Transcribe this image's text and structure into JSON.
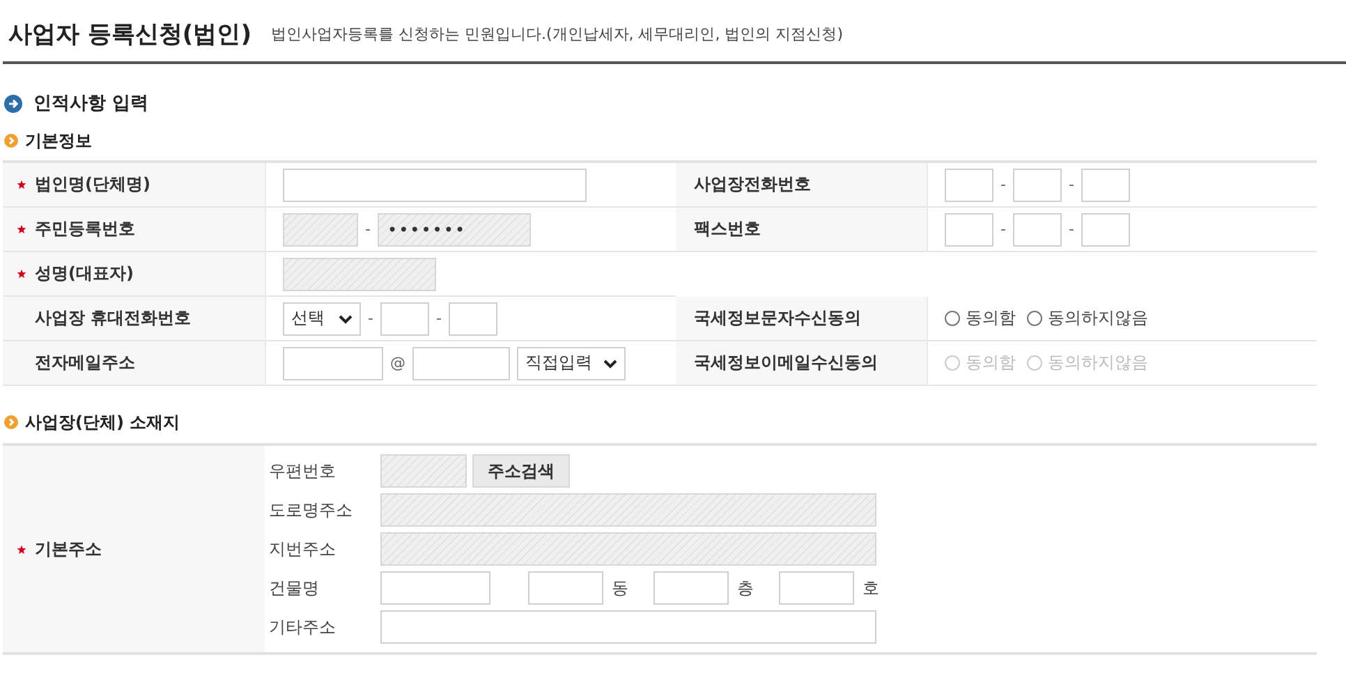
{
  "header": {
    "title": "사업자 등록신청(법인)",
    "description": "법인사업자등록를 신청하는 민원입니다.(개인납세자, 세무대리인, 법인의 지점신청)"
  },
  "section_title": "인적사항 입력",
  "basic_info": {
    "title": "기본정보",
    "rows": [
      {
        "left": {
          "label": "법인명(단체명)",
          "required": true,
          "kind": "text",
          "parts": [
            {
              "kind": "input",
              "disabled": false
            }
          ]
        },
        "right": {
          "label": "사업장전화번호",
          "required": false,
          "kind": "phone",
          "parts": [
            {
              "kind": "input",
              "disabled": false
            },
            {
              "kind": "sep",
              "text": "-"
            },
            {
              "kind": "input",
              "disabled": false
            },
            {
              "kind": "sep",
              "text": "-"
            },
            {
              "kind": "input",
              "disabled": false
            }
          ]
        }
      },
      {
        "left": {
          "label": "주민등록번호",
          "required": true,
          "kind": "rrn",
          "parts": [
            {
              "kind": "input",
              "disabled": true
            },
            {
              "kind": "sep",
              "text": "-"
            },
            {
              "kind": "input",
              "disabled": true,
              "value": "•••••••"
            }
          ]
        },
        "right": {
          "label": "팩스번호",
          "required": false,
          "kind": "phone",
          "parts": [
            {
              "kind": "input",
              "disabled": false
            },
            {
              "kind": "sep",
              "text": "-"
            },
            {
              "kind": "input",
              "disabled": false
            },
            {
              "kind": "sep",
              "text": "-"
            },
            {
              "kind": "input",
              "disabled": false
            }
          ]
        }
      },
      {
        "left": {
          "label": "성명(대표자)",
          "required": true,
          "kind": "readonly",
          "parts": [
            {
              "kind": "input",
              "disabled": true
            }
          ]
        }
      },
      {
        "left": {
          "label": "사업장 휴대전화번호",
          "required": false,
          "kind": "mobile",
          "parts": [
            {
              "kind": "select",
              "text": "선택"
            },
            {
              "kind": "sep",
              "text": "-"
            },
            {
              "kind": "input",
              "disabled": false
            },
            {
              "kind": "sep",
              "text": "-"
            },
            {
              "kind": "input",
              "disabled": false
            }
          ]
        },
        "right": {
          "label": "국세정보문자수신동의",
          "required": false,
          "kind": "consent",
          "parts": [
            {
              "kind": "radio",
              "text": "동의함",
              "selected": false,
              "disabled": false
            },
            {
              "kind": "radio",
              "text": "동의하지않음",
              "selected": false,
              "disabled": false
            }
          ]
        }
      },
      {
        "left": {
          "label": "전자메일주소",
          "required": false,
          "kind": "email",
          "parts": [
            {
              "kind": "input",
              "disabled": false
            },
            {
              "kind": "sep",
              "text": "@"
            },
            {
              "kind": "input",
              "disabled": false
            },
            {
              "kind": "select",
              "text": "직접입력"
            }
          ]
        },
        "right": {
          "label": "국세정보이메일수신동의",
          "required": false,
          "kind": "consent",
          "parts": [
            {
              "kind": "radio",
              "text": "동의함",
              "selected": false,
              "disabled": true
            },
            {
              "kind": "radio",
              "text": "동의하지않음",
              "selected": false,
              "disabled": true
            }
          ]
        }
      }
    ]
  },
  "location": {
    "title": "사업장(단체) 소재지",
    "label": "기본주소",
    "required": true,
    "lines": [
      {
        "label": "우편번호",
        "kind": "zip",
        "parts": [
          {
            "kind": "input",
            "disabled": true
          },
          {
            "kind": "button",
            "text": "주소검색"
          }
        ]
      },
      {
        "label": "도로명주소",
        "kind": "full",
        "parts": [
          {
            "kind": "input",
            "disabled": true
          }
        ]
      },
      {
        "label": "지번주소",
        "kind": "full",
        "parts": [
          {
            "kind": "input",
            "disabled": true
          }
        ]
      },
      {
        "label": "건물명",
        "kind": "building",
        "parts": [
          {
            "kind": "input",
            "disabled": false
          },
          {
            "kind": "input",
            "disabled": false
          },
          {
            "kind": "suffix",
            "text": "동"
          },
          {
            "kind": "input",
            "disabled": false
          },
          {
            "kind": "suffix",
            "text": "층"
          },
          {
            "kind": "input",
            "disabled": false
          },
          {
            "kind": "suffix",
            "text": "호"
          }
        ]
      },
      {
        "label": "기타주소",
        "kind": "full",
        "parts": [
          {
            "kind": "input",
            "disabled": false
          }
        ]
      }
    ]
  }
}
